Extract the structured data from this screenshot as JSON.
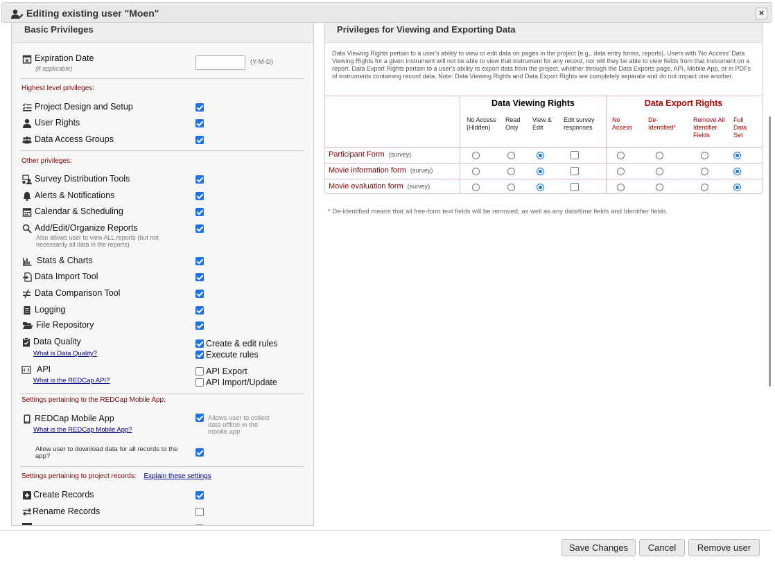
{
  "dialog": {
    "title": "Editing existing user \"Moen\"",
    "close_label": "×"
  },
  "left": {
    "header": "Basic Privileges",
    "expiration": {
      "label": "Expiration Date",
      "sub": "(if applicable)",
      "value": "",
      "format": "(Y-M-D)"
    },
    "highest_title": "Highest level privileges:",
    "highest": [
      {
        "label": "Project Design and Setup",
        "icon": "list-check-icon",
        "checked": true
      },
      {
        "label": "User Rights",
        "icon": "user-icon",
        "checked": true
      },
      {
        "label": "Data Access Groups",
        "icon": "users-icon",
        "checked": true
      }
    ],
    "other_title": "Other privileges:",
    "other": [
      {
        "label": "Survey Distribution Tools",
        "icon": "survey-distribution-icon",
        "checked": true
      },
      {
        "label": "Alerts & Notifications",
        "icon": "bell-icon",
        "checked": true
      },
      {
        "label": "Calendar & Scheduling",
        "icon": "calendar-icon",
        "checked": true
      },
      {
        "label": "Add/Edit/Organize Reports",
        "icon": "search-icon",
        "checked": true,
        "sub": "Also allows user to view ALL reports (but not necessarily all data in the reports)"
      },
      {
        "label": "Stats & Charts",
        "icon": "bar-chart-icon",
        "checked": true
      },
      {
        "label": "Data Import Tool",
        "icon": "file-import-icon",
        "checked": true
      },
      {
        "label": "Data Comparison Tool",
        "icon": "not-equal-icon",
        "checked": true
      },
      {
        "label": "Logging",
        "icon": "document-icon",
        "checked": true
      },
      {
        "label": "File Repository",
        "icon": "folder-open-icon",
        "checked": true
      }
    ],
    "data_quality": {
      "label": "Data Quality",
      "link": "What is Data Quality?",
      "opt1": "Create & edit rules",
      "opt1_checked": true,
      "opt2": "Execute rules",
      "opt2_checked": true
    },
    "api": {
      "label": "API",
      "link": "What is the REDCap API?",
      "opt1": "API Export",
      "opt1_checked": false,
      "opt2": "API Import/Update",
      "opt2_checked": false
    },
    "mobile_title": "Settings pertaining to the REDCap Mobile App:",
    "mobile": {
      "label": "REDCap Mobile App",
      "link": "What is the REDCap Mobile App?",
      "checked": true,
      "note": "Allows user to collect data offline in the mobile app",
      "download_label": "Allow user to download data for all records to the app?",
      "download_checked": true
    },
    "records_title": "Settings pertaining to project records:",
    "records_link": "Explain these settings",
    "records": [
      {
        "label": "Create Records",
        "icon": "plus-square-icon",
        "checked": true
      },
      {
        "label": "Rename Records",
        "icon": "arrows-exchange-icon",
        "checked": false
      }
    ]
  },
  "right": {
    "header": "Privileges for Viewing and Exporting Data",
    "description": "Data Viewing Rights pertain to a user's ability to view or edit data on pages in the project (e.g., data entry forms, reports). Users with 'No Access' Data Viewing Rights for a given instrument will not be able to view that instrument for any record, nor will they be able to view fields from that instrument on a report. Data Export Rights pertain to a user's ability to export data from the project, whether through the Data Exports page, API, Mobile App, or in PDFs of instruments containing record data. Note: Data Viewing Rights and Data Export Rights are completely separate and do not impact one another.",
    "viewing_title": "Data Viewing Rights",
    "export_title": "Data Export Rights",
    "viewing_cols": [
      "No Access (Hidden)",
      "Read Only",
      "View & Edit",
      "Edit survey responses"
    ],
    "export_cols": [
      "No Access",
      "De-Identified*",
      "Remove All Identifier Fields",
      "Full Data Set"
    ],
    "forms": [
      {
        "name": "Participant Form",
        "tag": "(survey)",
        "view": 2,
        "edit_survey": false,
        "export": 3
      },
      {
        "name": "Movie information form",
        "tag": "(survey)",
        "view": 2,
        "edit_survey": false,
        "export": 3
      },
      {
        "name": "Movie evaluation form",
        "tag": "(survey)",
        "view": 2,
        "edit_survey": false,
        "export": 3
      }
    ],
    "footnote": "* De-identified means that all free-form text fields will be removed, as well as any date/time fields and Identifier fields."
  },
  "buttons": {
    "save": "Save Changes",
    "cancel": "Cancel",
    "remove": "Remove user"
  },
  "colors": {
    "accent": "#1a73e8",
    "section_red": "#800000",
    "export_red": "#b00000"
  }
}
